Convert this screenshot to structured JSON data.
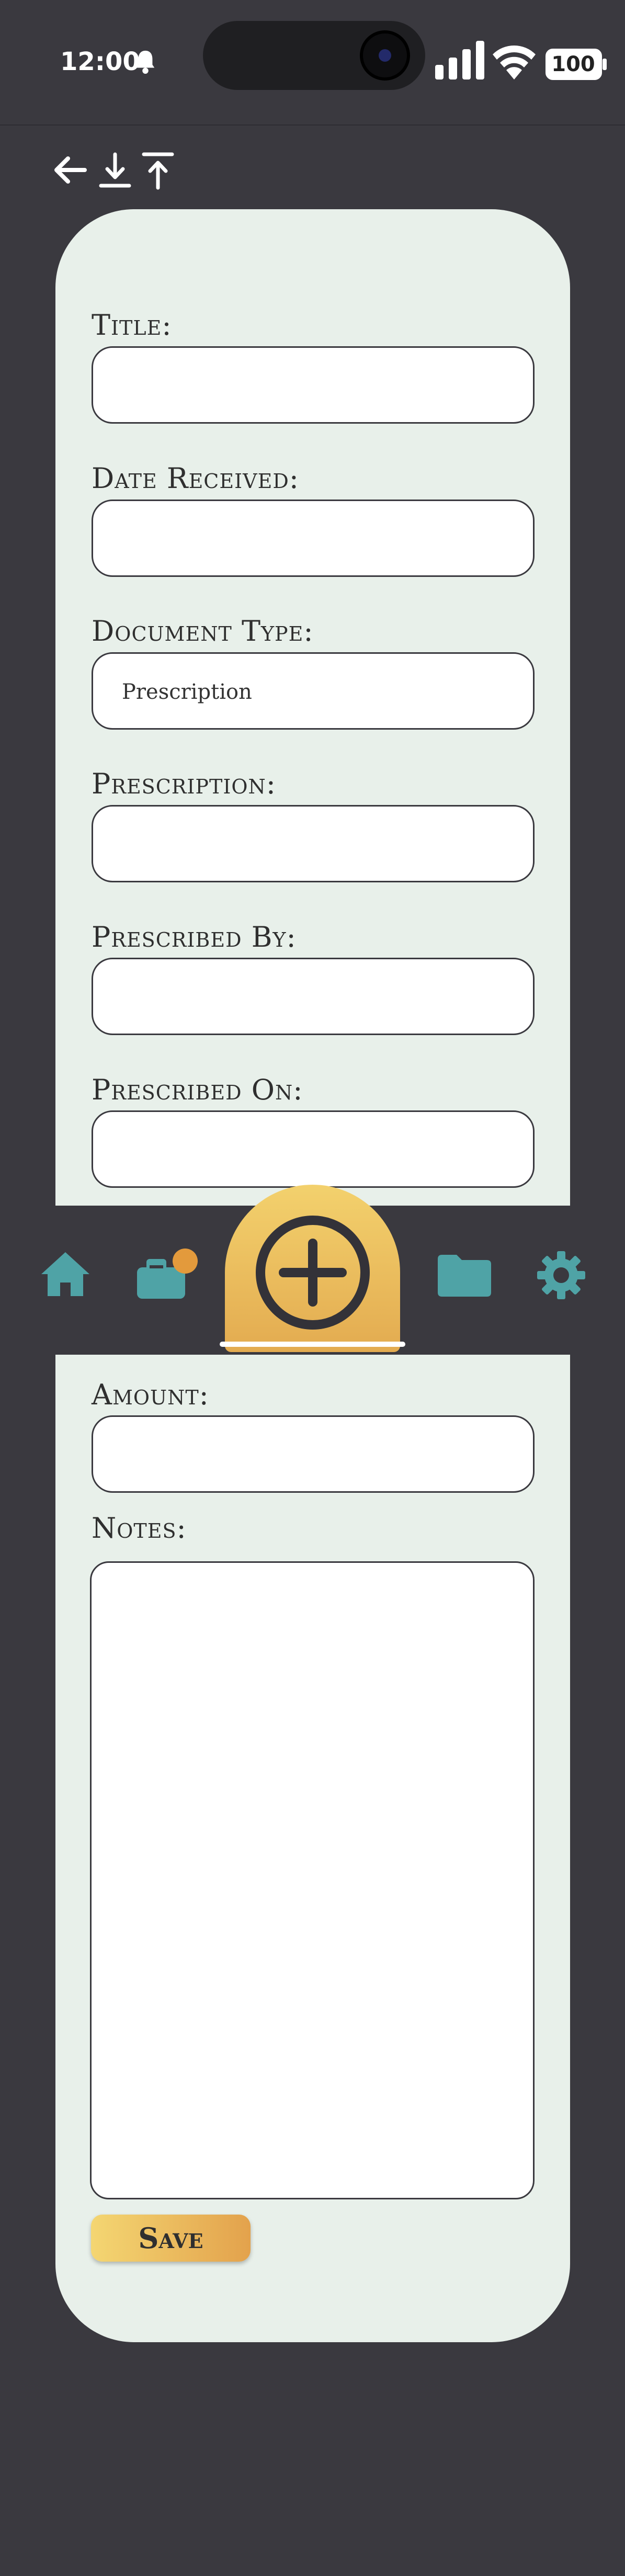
{
  "status_bar": {
    "time": "12:00",
    "battery": "100"
  },
  "toolbar": {
    "icons": [
      "back-arrow-icon",
      "download-icon",
      "upload-icon"
    ]
  },
  "form": {
    "title_label": "Title:",
    "title_value": "",
    "date_label": "Date Received:",
    "date_value": "",
    "doctype_label": "Document Type:",
    "doctype_value": "Prescription",
    "prescription_label": "Prescription:",
    "prescription_value": "",
    "prescribed_by_label": "Prescribed By:",
    "prescribed_by_value": "",
    "prescribed_on_label": "Prescribed On:",
    "prescribed_on_value": "",
    "amount_label": "Amount:",
    "amount_value": "",
    "notes_label": "Notes:",
    "notes_value": "",
    "save_label": "Save"
  },
  "bottom_nav": {
    "items": [
      "home-icon",
      "inbox-icon",
      "add-icon",
      "folder-icon",
      "settings-icon"
    ]
  },
  "colors": {
    "background": "#3a393f",
    "card": "#e8f0ea",
    "teal": "#4fa3a6",
    "gold": "#f0c35e",
    "badge": "#e39a3c"
  }
}
